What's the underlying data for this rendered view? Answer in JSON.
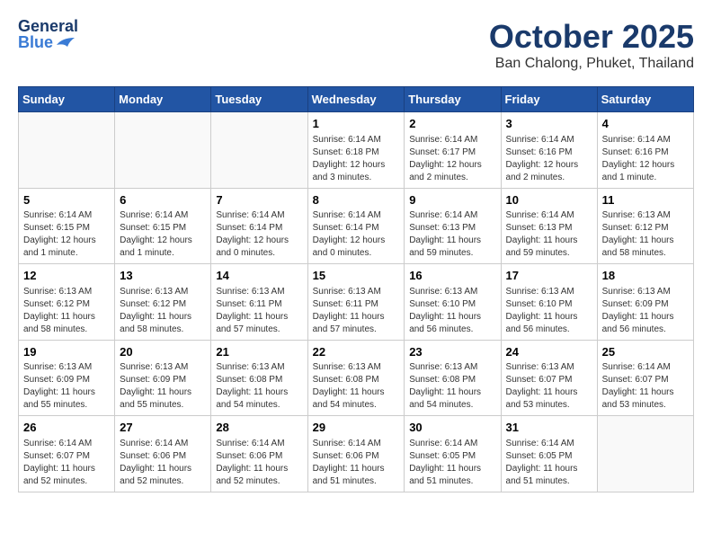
{
  "header": {
    "logo_general": "General",
    "logo_blue": "Blue",
    "month_title": "October 2025",
    "subtitle": "Ban Chalong, Phuket, Thailand"
  },
  "weekdays": [
    "Sunday",
    "Monday",
    "Tuesday",
    "Wednesday",
    "Thursday",
    "Friday",
    "Saturday"
  ],
  "weeks": [
    [
      {
        "day": "",
        "info": ""
      },
      {
        "day": "",
        "info": ""
      },
      {
        "day": "",
        "info": ""
      },
      {
        "day": "1",
        "info": "Sunrise: 6:14 AM\nSunset: 6:18 PM\nDaylight: 12 hours\nand 3 minutes."
      },
      {
        "day": "2",
        "info": "Sunrise: 6:14 AM\nSunset: 6:17 PM\nDaylight: 12 hours\nand 2 minutes."
      },
      {
        "day": "3",
        "info": "Sunrise: 6:14 AM\nSunset: 6:16 PM\nDaylight: 12 hours\nand 2 minutes."
      },
      {
        "day": "4",
        "info": "Sunrise: 6:14 AM\nSunset: 6:16 PM\nDaylight: 12 hours\nand 1 minute."
      }
    ],
    [
      {
        "day": "5",
        "info": "Sunrise: 6:14 AM\nSunset: 6:15 PM\nDaylight: 12 hours\nand 1 minute."
      },
      {
        "day": "6",
        "info": "Sunrise: 6:14 AM\nSunset: 6:15 PM\nDaylight: 12 hours\nand 1 minute."
      },
      {
        "day": "7",
        "info": "Sunrise: 6:14 AM\nSunset: 6:14 PM\nDaylight: 12 hours\nand 0 minutes."
      },
      {
        "day": "8",
        "info": "Sunrise: 6:14 AM\nSunset: 6:14 PM\nDaylight: 12 hours\nand 0 minutes."
      },
      {
        "day": "9",
        "info": "Sunrise: 6:14 AM\nSunset: 6:13 PM\nDaylight: 11 hours\nand 59 minutes."
      },
      {
        "day": "10",
        "info": "Sunrise: 6:14 AM\nSunset: 6:13 PM\nDaylight: 11 hours\nand 59 minutes."
      },
      {
        "day": "11",
        "info": "Sunrise: 6:13 AM\nSunset: 6:12 PM\nDaylight: 11 hours\nand 58 minutes."
      }
    ],
    [
      {
        "day": "12",
        "info": "Sunrise: 6:13 AM\nSunset: 6:12 PM\nDaylight: 11 hours\nand 58 minutes."
      },
      {
        "day": "13",
        "info": "Sunrise: 6:13 AM\nSunset: 6:12 PM\nDaylight: 11 hours\nand 58 minutes."
      },
      {
        "day": "14",
        "info": "Sunrise: 6:13 AM\nSunset: 6:11 PM\nDaylight: 11 hours\nand 57 minutes."
      },
      {
        "day": "15",
        "info": "Sunrise: 6:13 AM\nSunset: 6:11 PM\nDaylight: 11 hours\nand 57 minutes."
      },
      {
        "day": "16",
        "info": "Sunrise: 6:13 AM\nSunset: 6:10 PM\nDaylight: 11 hours\nand 56 minutes."
      },
      {
        "day": "17",
        "info": "Sunrise: 6:13 AM\nSunset: 6:10 PM\nDaylight: 11 hours\nand 56 minutes."
      },
      {
        "day": "18",
        "info": "Sunrise: 6:13 AM\nSunset: 6:09 PM\nDaylight: 11 hours\nand 56 minutes."
      }
    ],
    [
      {
        "day": "19",
        "info": "Sunrise: 6:13 AM\nSunset: 6:09 PM\nDaylight: 11 hours\nand 55 minutes."
      },
      {
        "day": "20",
        "info": "Sunrise: 6:13 AM\nSunset: 6:09 PM\nDaylight: 11 hours\nand 55 minutes."
      },
      {
        "day": "21",
        "info": "Sunrise: 6:13 AM\nSunset: 6:08 PM\nDaylight: 11 hours\nand 54 minutes."
      },
      {
        "day": "22",
        "info": "Sunrise: 6:13 AM\nSunset: 6:08 PM\nDaylight: 11 hours\nand 54 minutes."
      },
      {
        "day": "23",
        "info": "Sunrise: 6:13 AM\nSunset: 6:08 PM\nDaylight: 11 hours\nand 54 minutes."
      },
      {
        "day": "24",
        "info": "Sunrise: 6:13 AM\nSunset: 6:07 PM\nDaylight: 11 hours\nand 53 minutes."
      },
      {
        "day": "25",
        "info": "Sunrise: 6:14 AM\nSunset: 6:07 PM\nDaylight: 11 hours\nand 53 minutes."
      }
    ],
    [
      {
        "day": "26",
        "info": "Sunrise: 6:14 AM\nSunset: 6:07 PM\nDaylight: 11 hours\nand 52 minutes."
      },
      {
        "day": "27",
        "info": "Sunrise: 6:14 AM\nSunset: 6:06 PM\nDaylight: 11 hours\nand 52 minutes."
      },
      {
        "day": "28",
        "info": "Sunrise: 6:14 AM\nSunset: 6:06 PM\nDaylight: 11 hours\nand 52 minutes."
      },
      {
        "day": "29",
        "info": "Sunrise: 6:14 AM\nSunset: 6:06 PM\nDaylight: 11 hours\nand 51 minutes."
      },
      {
        "day": "30",
        "info": "Sunrise: 6:14 AM\nSunset: 6:05 PM\nDaylight: 11 hours\nand 51 minutes."
      },
      {
        "day": "31",
        "info": "Sunrise: 6:14 AM\nSunset: 6:05 PM\nDaylight: 11 hours\nand 51 minutes."
      },
      {
        "day": "",
        "info": ""
      }
    ]
  ]
}
